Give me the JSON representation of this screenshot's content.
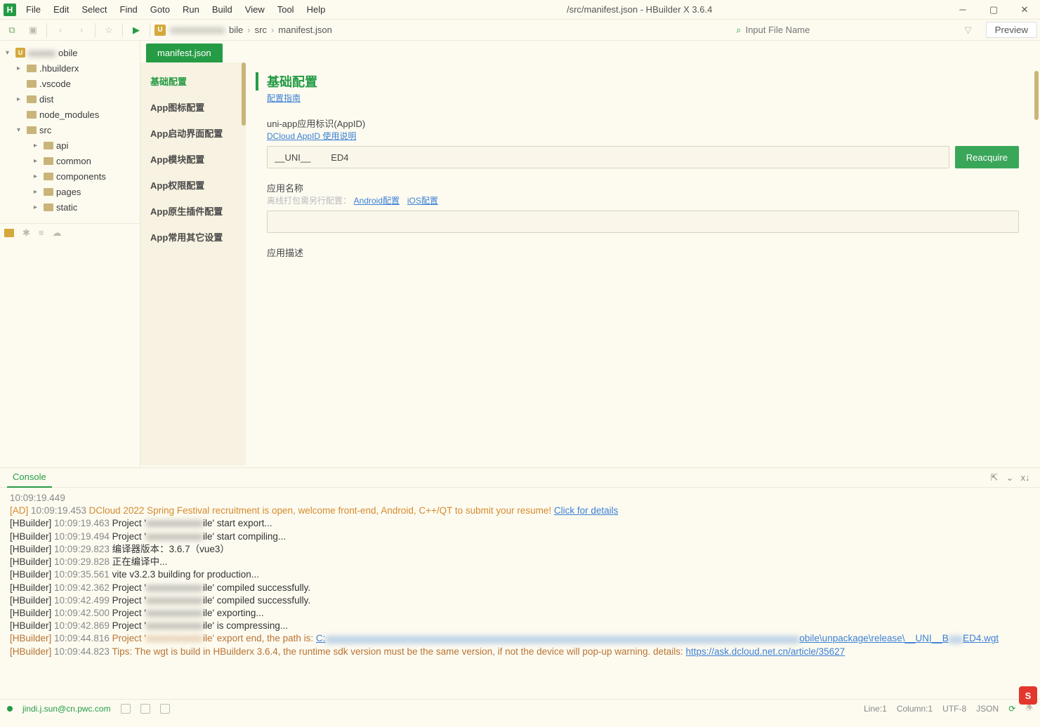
{
  "window": {
    "title": "/src/manifest.json - HBuilder X 3.6.4",
    "logo_letter": "H"
  },
  "menu": [
    "File",
    "Edit",
    "Select",
    "Find",
    "Goto",
    "Run",
    "Build",
    "View",
    "Tool",
    "Help"
  ],
  "toolbar": {
    "breadcrumb_project": "bile",
    "breadcrumb": [
      "src",
      "manifest.json"
    ],
    "search_placeholder": "Input File Name",
    "preview_label": "Preview"
  },
  "tree": {
    "root": "obile",
    "items": [
      {
        "label": ".hbuilderx",
        "depth": 1,
        "expandable": true
      },
      {
        "label": ".vscode",
        "depth": 1,
        "expandable": false
      },
      {
        "label": "dist",
        "depth": 1,
        "expandable": true
      },
      {
        "label": "node_modules",
        "depth": 1,
        "expandable": false
      },
      {
        "label": "src",
        "depth": 1,
        "expandable": true,
        "open": true
      },
      {
        "label": "api",
        "depth": 2,
        "expandable": true
      },
      {
        "label": "common",
        "depth": 2,
        "expandable": true
      },
      {
        "label": "components",
        "depth": 2,
        "expandable": true
      },
      {
        "label": "pages",
        "depth": 2,
        "expandable": true
      },
      {
        "label": "static",
        "depth": 2,
        "expandable": true
      }
    ]
  },
  "editor_tab": "manifest.json",
  "cfg_nav": [
    "基础配置",
    "App图标配置",
    "App启动界面配置",
    "App模块配置",
    "App权限配置",
    "App原生插件配置",
    "App常用其它设置"
  ],
  "cfg": {
    "section_title": "基础配置",
    "guide_link": "配置指南",
    "appid_label": "uni-app应用标识(AppID)",
    "appid_link": "DCloud AppID 使用说明",
    "appid_value": "__UNI__        ED4",
    "reacquire": "Reacquire",
    "appname_label": "应用名称",
    "appname_hint": "离线打包需另行配置：",
    "android_link": "Android配置",
    "ios_link": "iOS配置",
    "appname_value": "",
    "appdesc_label": "应用描述"
  },
  "console": {
    "tab": "Console",
    "lines": [
      {
        "parts": [
          {
            "cls": "c-time",
            "txt": "10:09:19.449"
          }
        ]
      },
      {
        "parts": [
          {
            "cls": "c-orange",
            "txt": "[AD] "
          },
          {
            "cls": "c-time",
            "txt": "10:09:19.453 "
          },
          {
            "cls": "c-orange",
            "txt": "DCloud 2022 Spring Festival recruitment is open, welcome front-end, Android, C++/QT to submit your resume! "
          },
          {
            "cls": "c-link",
            "txt": "Click for details"
          }
        ]
      },
      {
        "parts": [
          {
            "cls": "c-tag",
            "txt": "[HBuilder] "
          },
          {
            "cls": "c-time",
            "txt": "10:09:19.463 "
          },
          {
            "cls": "c-txt",
            "txt": "Project '"
          },
          {
            "cls": "blur c-txt",
            "txt": "xxxxxxxxxxxx"
          },
          {
            "cls": "c-txt",
            "txt": "ile' start export..."
          }
        ]
      },
      {
        "parts": [
          {
            "cls": "c-tag",
            "txt": "[HBuilder] "
          },
          {
            "cls": "c-time",
            "txt": "10:09:19.494 "
          },
          {
            "cls": "c-txt",
            "txt": "Project '"
          },
          {
            "cls": "blur c-txt",
            "txt": "xxxxxxxxxxxx"
          },
          {
            "cls": "c-txt",
            "txt": "ile' start compiling..."
          }
        ]
      },
      {
        "parts": [
          {
            "cls": "c-tag",
            "txt": "[HBuilder] "
          },
          {
            "cls": "c-time",
            "txt": "10:09:29.823 "
          },
          {
            "cls": "c-txt",
            "txt": "编译器版本：3.6.7（vue3）"
          }
        ]
      },
      {
        "parts": [
          {
            "cls": "c-tag",
            "txt": "[HBuilder] "
          },
          {
            "cls": "c-time",
            "txt": "10:09:29.828 "
          },
          {
            "cls": "c-txt",
            "txt": "正在编译中..."
          }
        ]
      },
      {
        "parts": [
          {
            "cls": "c-tag",
            "txt": "[HBuilder] "
          },
          {
            "cls": "c-time",
            "txt": "10:09:35.561 "
          },
          {
            "cls": "c-txt",
            "txt": "vite v3.2.3 building for production..."
          }
        ]
      },
      {
        "parts": [
          {
            "cls": "c-tag",
            "txt": "[HBuilder] "
          },
          {
            "cls": "c-time",
            "txt": "10:09:42.362 "
          },
          {
            "cls": "c-txt",
            "txt": "Project '"
          },
          {
            "cls": "blur c-txt",
            "txt": "xxxxxxxxxxxx"
          },
          {
            "cls": "c-txt",
            "txt": "ile' compiled successfully."
          }
        ]
      },
      {
        "parts": [
          {
            "cls": "c-tag",
            "txt": "[HBuilder] "
          },
          {
            "cls": "c-time",
            "txt": "10:09:42.499 "
          },
          {
            "cls": "c-txt",
            "txt": "Project '"
          },
          {
            "cls": "blur c-txt",
            "txt": "xxxxxxxxxxxx"
          },
          {
            "cls": "c-txt",
            "txt": "ile' compiled successfully."
          }
        ]
      },
      {
        "parts": [
          {
            "cls": "c-tag",
            "txt": "[HBuilder] "
          },
          {
            "cls": "c-time",
            "txt": "10:09:42.500 "
          },
          {
            "cls": "c-txt",
            "txt": "Project '"
          },
          {
            "cls": "blur c-txt",
            "txt": "xxxxxxxxxxxx"
          },
          {
            "cls": "c-txt",
            "txt": "ile' exporting..."
          }
        ]
      },
      {
        "parts": [
          {
            "cls": "c-tag",
            "txt": "[HBuilder] "
          },
          {
            "cls": "c-time",
            "txt": "10:09:42.869 "
          },
          {
            "cls": "c-txt",
            "txt": "Project '"
          },
          {
            "cls": "blur c-txt",
            "txt": "xxxxxxxxxxxx"
          },
          {
            "cls": "c-txt",
            "txt": "ile' is compressing..."
          }
        ]
      },
      {
        "parts": [
          {
            "cls": "c-brown",
            "txt": "[HBuilder] "
          },
          {
            "cls": "c-time",
            "txt": "10:09:44.816 "
          },
          {
            "cls": "c-brown",
            "txt": "Project '"
          },
          {
            "cls": "blur c-brown",
            "txt": "xxxxxxxxxxxx"
          },
          {
            "cls": "c-brown",
            "txt": "ile' export end, the path is: "
          },
          {
            "cls": "c-link",
            "txt": "C:"
          },
          {
            "cls": "blur c-link",
            "txt": "xxxxxxxxxxxxxxxxxxxxxxxxxxxxxxxxxxxxxxxxxxxxxxxxxxxxxxxxxxxxxxxxxxxxxxxxxxxxxxxxxxxxxxxxxxxxxxxxxxxx"
          },
          {
            "cls": "c-link",
            "txt": "obile\\unpackage\\release\\__UNI__B"
          },
          {
            "cls": "blur c-link",
            "txt": "xxx"
          },
          {
            "cls": "c-link",
            "txt": "ED4.wgt"
          }
        ]
      },
      {
        "parts": [
          {
            "cls": "c-brown",
            "txt": "[HBuilder] "
          },
          {
            "cls": "c-time",
            "txt": "10:09:44.823 "
          },
          {
            "cls": "c-brown",
            "txt": "Tips: The wgt is build in HBuilderx 3.6.4, the runtime sdk version must be the same version, if not the device will pop-up warning. details: "
          },
          {
            "cls": "c-link",
            "txt": "https://ask.dcloud.net.cn/article/35627"
          }
        ]
      }
    ]
  },
  "status": {
    "user": "jindi.j.sun@cn.pwc.com",
    "line": "Line:1",
    "col": "Column:1",
    "enc": "UTF-8",
    "lang": "JSON"
  },
  "input_indicator": "S"
}
